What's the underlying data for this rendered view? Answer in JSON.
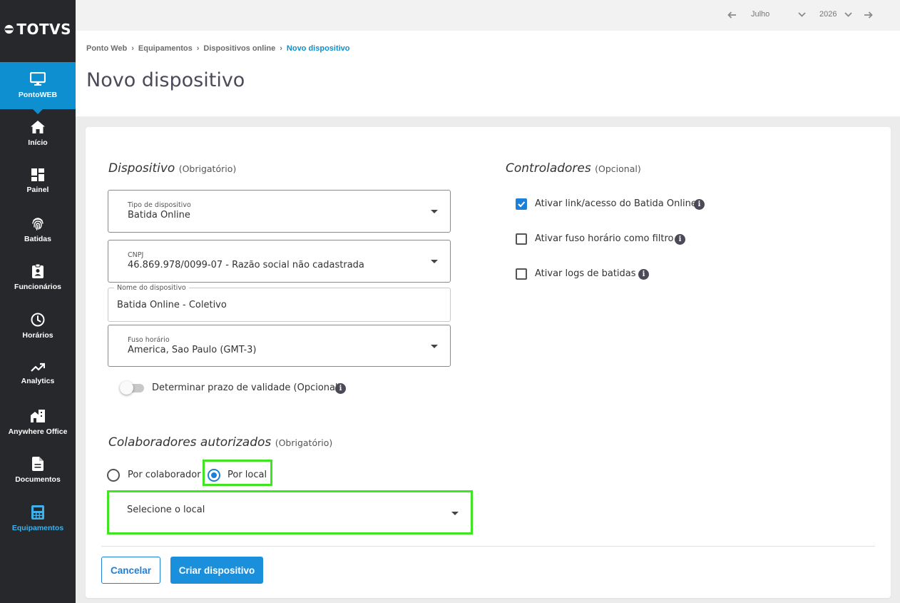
{
  "brand": {
    "logo_text": "TOTVS"
  },
  "sidebar": {
    "app": "PontoWEB",
    "items": [
      {
        "label": "Início",
        "icon": "home-icon"
      },
      {
        "label": "Painel",
        "icon": "dashboard-icon"
      },
      {
        "label": "Batidas",
        "icon": "fingerprint-icon"
      },
      {
        "label": "Funcionários",
        "icon": "badge-icon"
      },
      {
        "label": "Horários",
        "icon": "clock-icon"
      },
      {
        "label": "Analytics",
        "icon": "trending-icon"
      },
      {
        "label": "Anywhere Office",
        "icon": "building-icon"
      },
      {
        "label": "Documentos",
        "icon": "document-icon"
      },
      {
        "label": "Equipamentos",
        "icon": "device-icon"
      }
    ]
  },
  "topbar": {
    "month": "Julho",
    "year": "2026"
  },
  "breadcrumb": {
    "items": [
      "Ponto Web",
      "Equipamentos",
      "Dispositivos online"
    ],
    "current": "Novo dispositivo",
    "separator": "›"
  },
  "page": {
    "title": "Novo dispositivo"
  },
  "device": {
    "title": "Dispositivo",
    "note": "(Obrigatório)",
    "type_label": "Tipo de dispositivo",
    "type_value": "Batida Online",
    "cnpj_label": "CNPJ",
    "cnpj_value": "46.869.978/0099-07 - Razão social não cadastrada",
    "name_label": "Nome do dispositivo",
    "name_value": "Batida Online - Coletivo",
    "tz_label": "Fuso horário",
    "tz_value": "America, Sao Paulo (GMT-3)",
    "validity_label": "Determinar prazo de validade (Opcional)",
    "validity_enabled": false
  },
  "controllers": {
    "title": "Controladores",
    "note": "(Opcional)",
    "options": [
      {
        "label": "Ativar link/acesso do Batida Online",
        "checked": true
      },
      {
        "label": "Ativar fuso horário como filtro",
        "checked": false
      },
      {
        "label": "Ativar logs de batidas",
        "checked": false
      }
    ]
  },
  "collaborators": {
    "title": "Colaboradores autorizados",
    "note": "(Obrigatório)",
    "option_collaborator": "Por colaborador",
    "option_location": "Por local",
    "selected": "Por local",
    "location_placeholder": "Selecione o local"
  },
  "actions": {
    "cancel": "Cancelar",
    "create": "Criar dispositivo"
  },
  "colors": {
    "accent": "#0e8fcf",
    "sidebar": "#27282c",
    "highlight": "#3fe521",
    "checked": "#1f7fd6"
  }
}
